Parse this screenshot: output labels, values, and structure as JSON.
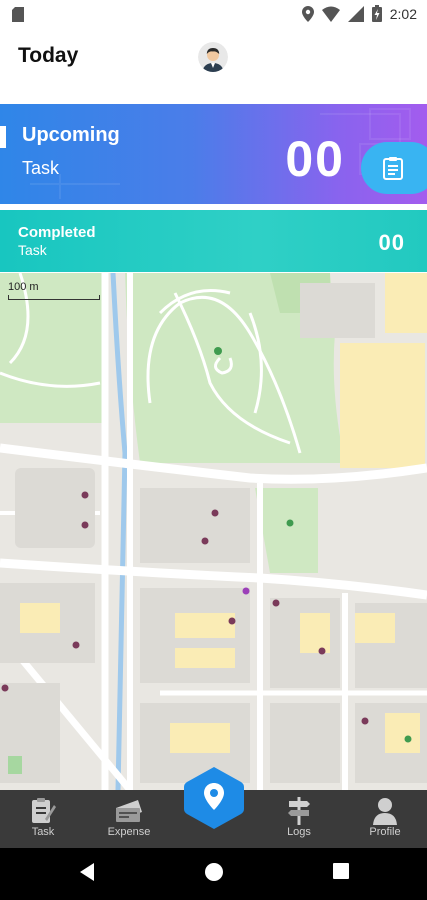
{
  "status_bar": {
    "time": "2:02"
  },
  "header": {
    "title": "Today"
  },
  "upcoming": {
    "label": "Upcoming",
    "sub": "Task",
    "count": "00"
  },
  "completed": {
    "label": "Completed",
    "sub": "Task",
    "count": "00"
  },
  "map": {
    "scale_label": "100 m"
  },
  "bottom_nav": {
    "items": [
      {
        "label": "Task"
      },
      {
        "label": "Expense"
      },
      {
        "label": "Logs"
      },
      {
        "label": "Profile"
      }
    ]
  },
  "colors": {
    "upcoming_start": "#2f86e8",
    "upcoming_end": "#a35cee",
    "completed": "#22c9c0",
    "fab": "#1e8be6",
    "nav_bg": "#3a3a3a",
    "park": "#cfe8c2",
    "map_bg": "#e9e7e2",
    "building_yellow": "#faecb5",
    "water": "#9fc9ec"
  }
}
